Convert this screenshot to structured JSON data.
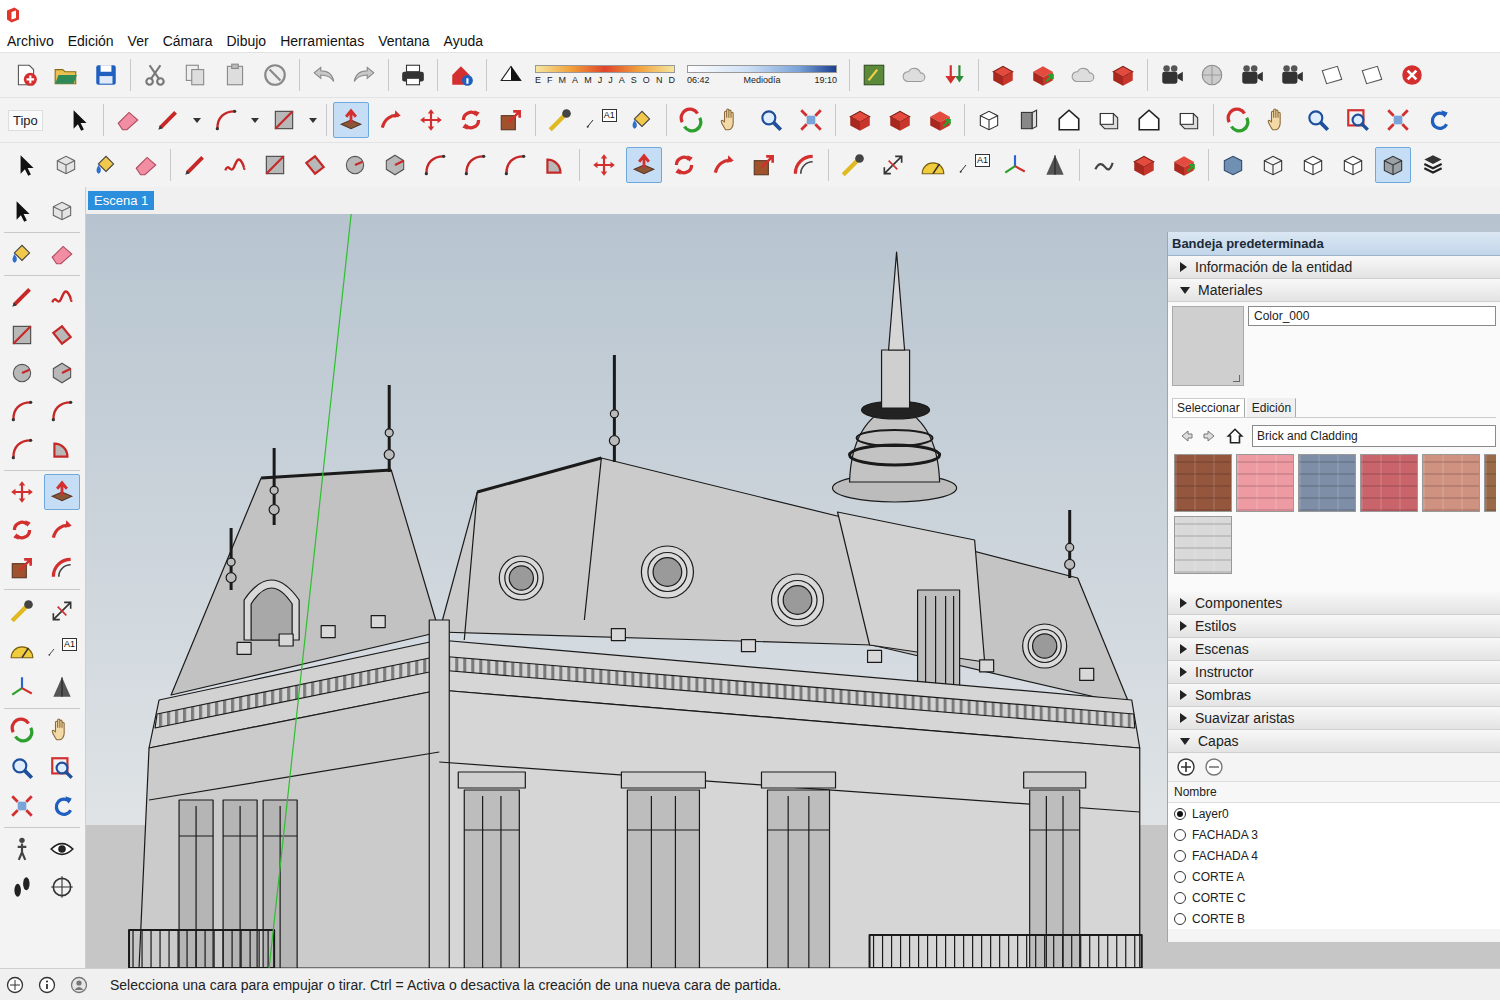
{
  "menu": [
    "Archivo",
    "Edición",
    "Ver",
    "Cámara",
    "Dibujo",
    "Herramientas",
    "Ventana",
    "Ayuda"
  ],
  "toolbar_row_1": {
    "groups_before": [
      [
        {
          "kind": "new",
          "selected": false
        },
        {
          "kind": "open",
          "selected": false
        },
        {
          "kind": "save",
          "selected": false
        }
      ],
      [
        {
          "kind": "cut",
          "selected": false
        },
        {
          "kind": "copy",
          "selected": false
        },
        {
          "kind": "paste",
          "selected": false
        },
        {
          "kind": "delete",
          "selected": false
        }
      ],
      [
        {
          "kind": "undo",
          "selected": false
        },
        {
          "kind": "redo",
          "selected": false
        }
      ],
      [
        {
          "kind": "print",
          "selected": false
        }
      ],
      [
        {
          "kind": "info",
          "selected": false
        }
      ],
      [
        {
          "kind": "shadow",
          "selected": false
        }
      ]
    ],
    "shadow_settings": {
      "months": [
        "E",
        "F",
        "M",
        "A",
        "M",
        "J",
        "J",
        "A",
        "S",
        "O",
        "N",
        "D"
      ],
      "time_start": "06:42",
      "time_mid": "Mediodía",
      "time_end": "19:10"
    },
    "groups_after": [
      [
        {
          "kind": "geo",
          "selected": false
        },
        {
          "kind": "cloud",
          "selected": false
        },
        {
          "kind": "download",
          "selected": false
        }
      ],
      [
        {
          "kind": "warehouse",
          "selected": false
        },
        {
          "kind": "share",
          "selected": false
        },
        {
          "kind": "cloud",
          "selected": false
        },
        {
          "kind": "warehouse",
          "selected": false
        }
      ],
      [
        {
          "kind": "camera",
          "selected": false
        },
        {
          "kind": "globe",
          "selected": false
        },
        {
          "kind": "camera",
          "selected": false
        },
        {
          "kind": "camera",
          "selected": false
        },
        {
          "kind": "plane",
          "selected": false
        },
        {
          "kind": "plane",
          "selected": false
        },
        {
          "kind": "close",
          "selected": false
        }
      ]
    ]
  },
  "toolbar_row_2": {
    "lead_label": "Tipo",
    "groups": [
      [
        {
          "kind": "select",
          "selected": false,
          "dropdown": false
        }
      ],
      [
        {
          "kind": "eraser",
          "selected": false,
          "dropdown": false
        },
        {
          "kind": "pencil",
          "selected": false,
          "dropdown": true
        },
        {
          "kind": "arc",
          "selected": false,
          "dropdown": true
        },
        {
          "kind": "rect",
          "selected": false,
          "dropdown": true
        }
      ],
      [
        {
          "kind": "push",
          "selected": true,
          "dropdown": false
        },
        {
          "kind": "follow",
          "selected": false,
          "dropdown": false
        },
        {
          "kind": "move",
          "selected": false,
          "dropdown": false
        },
        {
          "kind": "rotate",
          "selected": false,
          "dropdown": false
        },
        {
          "kind": "scale",
          "selected": false,
          "dropdown": false
        }
      ],
      [
        {
          "kind": "tape",
          "selected": false,
          "dropdown": false
        },
        {
          "kind": "text",
          "selected": false,
          "dropdown": false,
          "label": "A1"
        },
        {
          "kind": "paint",
          "selected": false,
          "dropdown": false
        }
      ],
      [
        {
          "kind": "orbit",
          "selected": false,
          "dropdown": false
        },
        {
          "kind": "pan",
          "selected": false,
          "dropdown": false
        },
        {
          "kind": "zoom",
          "selected": false,
          "dropdown": false
        },
        {
          "kind": "extents",
          "selected": false,
          "dropdown": false
        }
      ],
      [
        {
          "kind": "warehouse",
          "selected": false,
          "dropdown": false
        },
        {
          "kind": "warehouse",
          "selected": false,
          "dropdown": false
        },
        {
          "kind": "share",
          "selected": false,
          "dropdown": false
        }
      ],
      [
        {
          "kind": "iso",
          "selected": false,
          "dropdown": false
        },
        {
          "kind": "side",
          "selected": false,
          "dropdown": false
        },
        {
          "kind": "house",
          "selected": false,
          "dropdown": false
        },
        {
          "kind": "top",
          "selected": false,
          "dropdown": false
        },
        {
          "kind": "house",
          "selected": false,
          "dropdown": false
        },
        {
          "kind": "top",
          "selected": false,
          "dropdown": false
        }
      ],
      [
        {
          "kind": "orbit",
          "selected": false,
          "dropdown": false
        },
        {
          "kind": "pan",
          "selected": false,
          "dropdown": false
        },
        {
          "kind": "zoom",
          "selected": false,
          "dropdown": false
        },
        {
          "kind": "zoomwin",
          "selected": false,
          "dropdown": false
        },
        {
          "kind": "extents",
          "selected": false,
          "dropdown": false
        },
        {
          "kind": "previous",
          "selected": false,
          "dropdown": false
        }
      ]
    ]
  },
  "toolbar_row_3": {
    "groups": [
      [
        {
          "kind": "select",
          "selected": false
        },
        {
          "kind": "component",
          "selected": false
        },
        {
          "kind": "paint",
          "selected": false
        },
        {
          "kind": "eraser",
          "selected": false
        }
      ],
      [
        {
          "kind": "pencil",
          "selected": false
        },
        {
          "kind": "freehand",
          "selected": false
        },
        {
          "kind": "rect",
          "selected": false
        },
        {
          "kind": "rotrect",
          "selected": false
        },
        {
          "kind": "circle",
          "selected": false
        },
        {
          "kind": "polygon",
          "selected": false
        },
        {
          "kind": "arc",
          "selected": false
        },
        {
          "kind": "arc",
          "selected": false
        },
        {
          "kind": "arc",
          "selected": false
        },
        {
          "kind": "pie",
          "selected": false
        }
      ],
      [
        {
          "kind": "move",
          "selected": false
        },
        {
          "kind": "push",
          "selected": true
        },
        {
          "kind": "rotate",
          "selected": false
        },
        {
          "kind": "follow",
          "selected": false
        },
        {
          "kind": "scale",
          "selected": false
        },
        {
          "kind": "offset",
          "selected": false
        }
      ],
      [
        {
          "kind": "tape",
          "selected": false
        },
        {
          "kind": "dimension",
          "selected": false
        },
        {
          "kind": "protractor",
          "selected": false
        },
        {
          "kind": "text",
          "selected": false,
          "label": "A1"
        },
        {
          "kind": "axes",
          "selected": false
        },
        {
          "kind": "text3d",
          "selected": false
        }
      ],
      [
        {
          "kind": "sandbox",
          "selected": false
        },
        {
          "kind": "warehouse",
          "selected": false
        },
        {
          "kind": "share",
          "selected": false
        }
      ],
      [
        {
          "kind": "xray",
          "selected": false
        },
        {
          "kind": "wire",
          "selected": false
        },
        {
          "kind": "hidden",
          "selected": false
        },
        {
          "kind": "hidden",
          "selected": false
        },
        {
          "kind": "shaded",
          "selected": true
        },
        {
          "kind": "mono",
          "selected": false
        }
      ]
    ]
  },
  "scene_tabs": [
    {
      "label": "Escena 1",
      "selected": true
    }
  ],
  "left_toolbar": {
    "groups": [
      [
        {
          "kind": "select",
          "selected": false
        },
        {
          "kind": "component",
          "selected": false
        }
      ],
      [
        {
          "kind": "paint",
          "selected": false
        },
        {
          "kind": "eraser",
          "selected": false
        }
      ],
      [
        {
          "kind": "pencil",
          "selected": false
        },
        {
          "kind": "freehand",
          "selected": false
        },
        {
          "kind": "rect",
          "selected": false
        },
        {
          "kind": "rotrect",
          "selected": false
        },
        {
          "kind": "circle",
          "selected": false
        },
        {
          "kind": "polygon",
          "selected": false
        },
        {
          "kind": "arc",
          "selected": false
        },
        {
          "kind": "arc",
          "selected": false
        },
        {
          "kind": "arc",
          "selected": false
        },
        {
          "kind": "pie",
          "selected": false
        }
      ],
      [
        {
          "kind": "move",
          "selected": false
        },
        {
          "kind": "push",
          "selected": true
        },
        {
          "kind": "rotate",
          "selected": false
        },
        {
          "kind": "follow",
          "selected": false
        },
        {
          "kind": "scale",
          "selected": false
        },
        {
          "kind": "offset",
          "selected": false
        }
      ],
      [
        {
          "kind": "tape",
          "selected": false
        },
        {
          "kind": "dimension",
          "selected": false
        },
        {
          "kind": "protractor",
          "selected": false
        },
        {
          "kind": "text",
          "selected": false,
          "label": "A1"
        },
        {
          "kind": "axes",
          "selected": false
        },
        {
          "kind": "text3d",
          "selected": false
        }
      ],
      [
        {
          "kind": "orbit",
          "selected": false
        },
        {
          "kind": "pan",
          "selected": false
        },
        {
          "kind": "zoom",
          "selected": false
        },
        {
          "kind": "zoomwin",
          "selected": false
        },
        {
          "kind": "extents",
          "selected": false
        },
        {
          "kind": "previous",
          "selected": false
        }
      ],
      [
        {
          "kind": "walk",
          "selected": false
        },
        {
          "kind": "eye",
          "selected": false
        },
        {
          "kind": "foot",
          "selected": false
        },
        {
          "kind": "sectionplane",
          "selected": false
        }
      ]
    ]
  },
  "tray": {
    "title": "Bandeja predeterminada",
    "sections_top": [
      {
        "label": "Información de la entidad",
        "expanded": false
      },
      {
        "label": "Materiales",
        "expanded": true
      }
    ],
    "materials": {
      "name": "Color_000",
      "tabs": [
        {
          "label": "Seleccionar",
          "selected": true
        },
        {
          "label": "Edición",
          "selected": false
        }
      ],
      "collection": "Brick and Cladding",
      "swatches": [
        {
          "color": "#94563d"
        },
        {
          "color": "#ee9aa3"
        },
        {
          "color": "#7d8ea6"
        },
        {
          "color": "#c9646b"
        },
        {
          "color": "#cf9280"
        },
        {
          "color": "#9a6a48"
        },
        {
          "color": "#d9d9d9"
        }
      ]
    },
    "sections_bottom": [
      {
        "label": "Componentes",
        "expanded": false
      },
      {
        "label": "Estilos",
        "expanded": false
      },
      {
        "label": "Escenas",
        "expanded": false
      },
      {
        "label": "Instructor",
        "expanded": false
      },
      {
        "label": "Sombras",
        "expanded": false
      },
      {
        "label": "Suavizar aristas",
        "expanded": false
      },
      {
        "label": "Capas",
        "expanded": true
      }
    ],
    "layers": {
      "header": "Nombre",
      "items": [
        {
          "name": "Layer0",
          "selected": true
        },
        {
          "name": "FACHADA 3",
          "selected": false
        },
        {
          "name": "FACHADA 4",
          "selected": false
        },
        {
          "name": "CORTE A",
          "selected": false
        },
        {
          "name": "CORTE C",
          "selected": false
        },
        {
          "name": "CORTE B",
          "selected": false
        }
      ]
    }
  },
  "status_bar": {
    "text": "Selecciona una cara para empujar o tirar. Ctrl = Activa o desactiva la creación de una nueva cara de partida."
  }
}
